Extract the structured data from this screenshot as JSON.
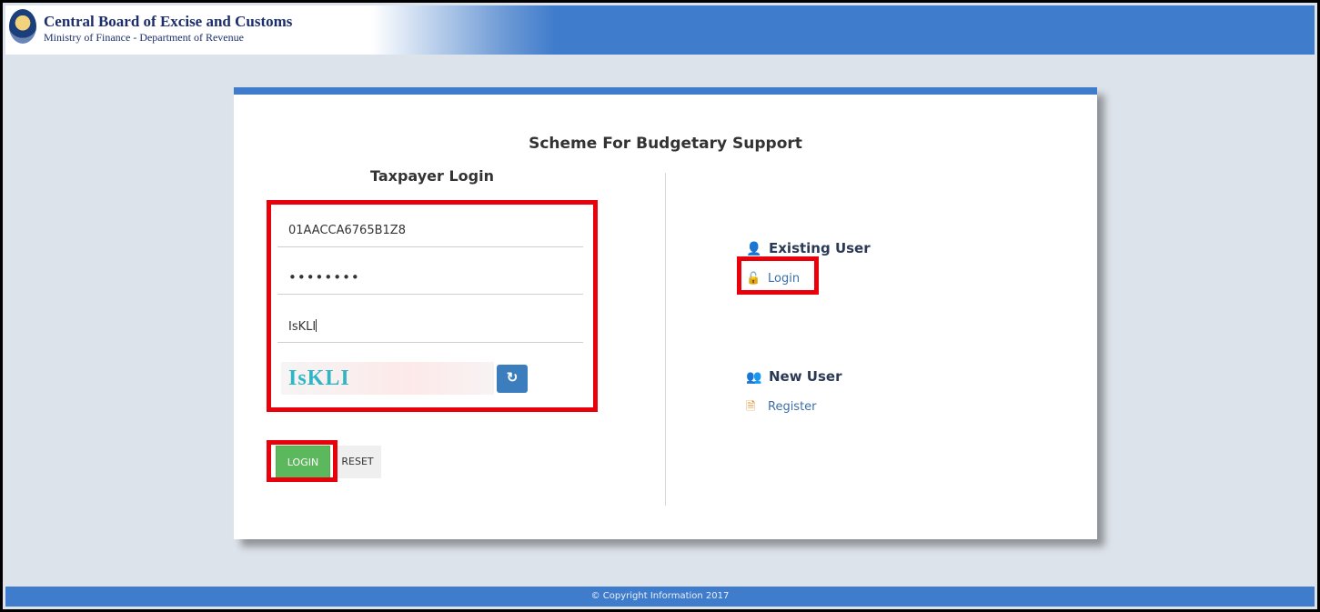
{
  "header": {
    "title": "Central Board of Excise and Customs",
    "subtitle": "Ministry of Finance - Department of Revenue",
    "emblem_icon": "national-emblem-icon"
  },
  "card": {
    "scheme_title": "Scheme For Budgetary Support",
    "login_title": "Taxpayer Login",
    "fields": {
      "gstin_value": "01AACCA6765B1Z8",
      "password_value": "••••••••",
      "captcha_input_value": "IsKLI"
    },
    "captcha": {
      "image_text": "IsKLI",
      "refresh_icon": "refresh-icon",
      "refresh_glyph": "↻"
    },
    "buttons": {
      "login_label": "LOGIN",
      "reset_label": "RESET"
    },
    "existing_user": {
      "heading": "Existing User",
      "icon": "user-icon",
      "icon_glyph": "👤",
      "link_label": "Login",
      "link_icon": "unlock-icon",
      "link_glyph": "🔓"
    },
    "new_user": {
      "heading": "New User",
      "icon": "add-user-icon",
      "icon_glyph": "👥",
      "link_label": "Register",
      "link_icon": "document-icon",
      "link_glyph": "🗎"
    }
  },
  "footer": {
    "text": "© Copyright Information 2017"
  },
  "colors": {
    "brand_blue": "#3f7ccb",
    "login_green": "#5cb85c",
    "highlight_red": "#e8000b",
    "link_blue": "#3b6fa8",
    "icon_orange": "#e08a1e"
  }
}
